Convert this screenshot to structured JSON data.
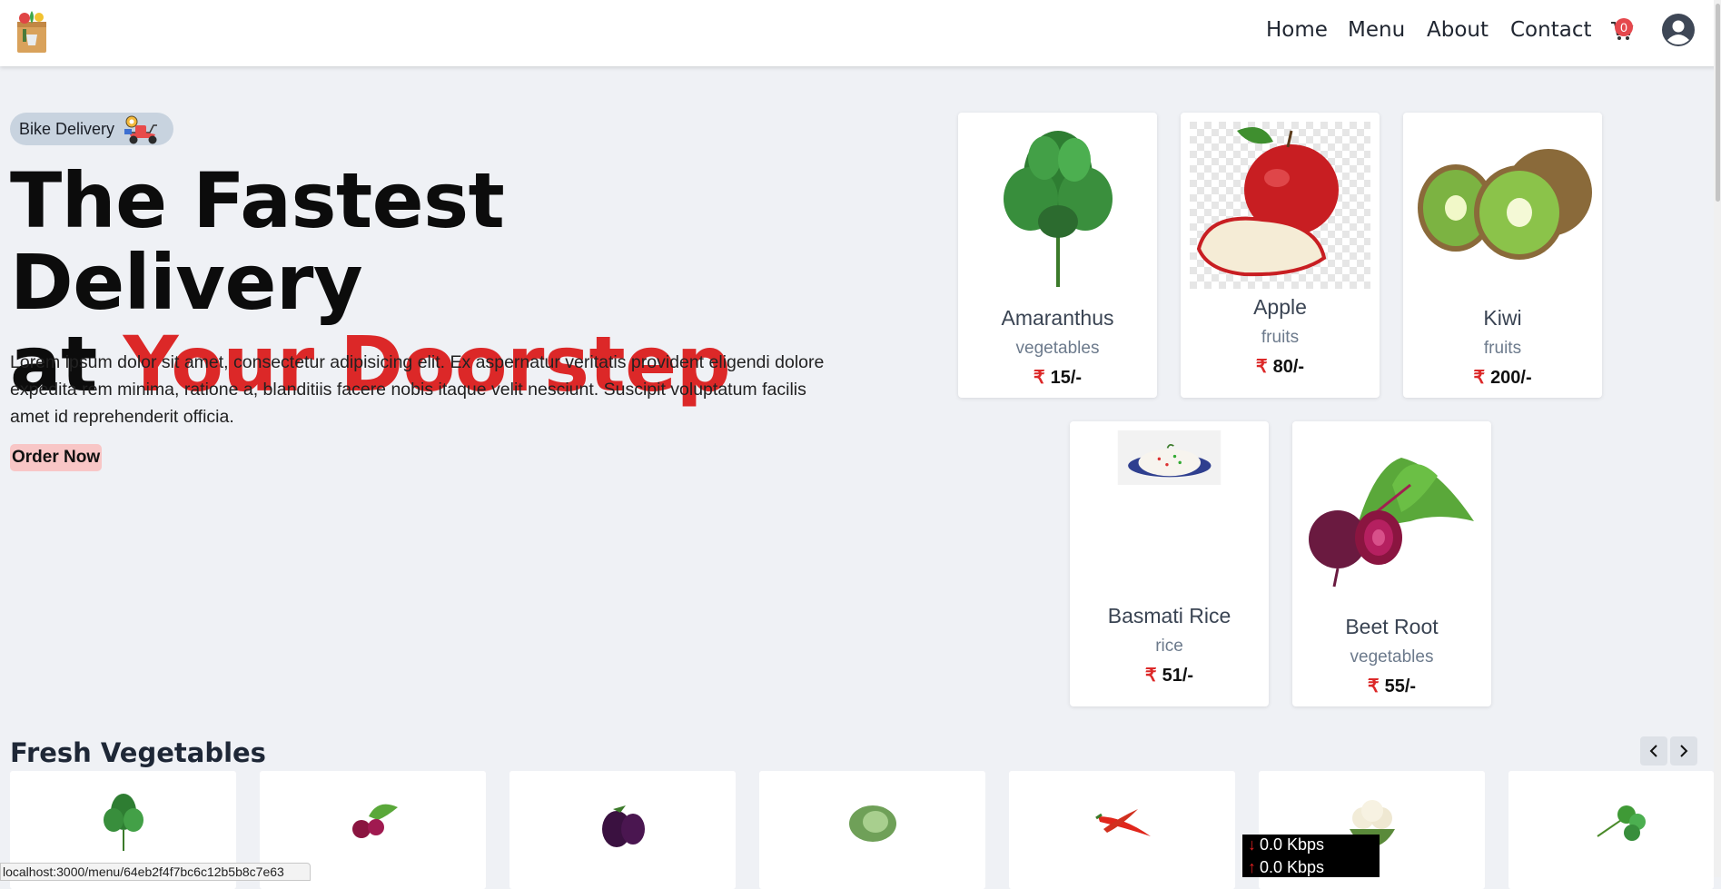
{
  "header": {
    "logo_icon": "grocery-bag-icon",
    "nav": [
      {
        "label": "Home"
      },
      {
        "label": "Menu"
      },
      {
        "label": "About"
      },
      {
        "label": "Contact"
      }
    ],
    "cart_icon": "cart-icon",
    "cart_count": "0",
    "avatar_icon": "user-avatar-icon"
  },
  "hero": {
    "badge_label": "Bike Delivery",
    "badge_icon": "scooter-delivery-icon",
    "title_line1": "The Fastest Delivery",
    "title_line2_prefix": "at",
    "title_line2_highlight": "Your Doorstep",
    "description": "Lorem ipsum dolor sit amet, consectetur adipisicing elit. Ex aspernatur veritatis provident eligendi dolore expedita rem minima, ratione a, blanditiis facere nobis itaque velit nesciunt. Suscipit voluptatum facilis amet id reprehenderit officia.",
    "order_button": "Order Now",
    "accent_color": "#dc2828"
  },
  "products": [
    {
      "name": "Amaranthus",
      "category": "vegetables",
      "price": "15/-",
      "currency": "₹",
      "image_icon": "amaranthus-leaf-icon"
    },
    {
      "name": "Apple",
      "category": "fruits",
      "price": "80/-",
      "currency": "₹",
      "image_icon": "apple-icon"
    },
    {
      "name": "Kiwi",
      "category": "fruits",
      "price": "200/-",
      "currency": "₹",
      "image_icon": "kiwi-icon"
    },
    {
      "name": "Basmati Rice",
      "category": "rice",
      "price": "51/-",
      "currency": "₹",
      "image_icon": "rice-plate-icon"
    },
    {
      "name": "Beet Root",
      "category": "vegetables",
      "price": "55/-",
      "currency": "₹",
      "image_icon": "beetroot-icon"
    }
  ],
  "fresh_vegetables": {
    "title": "Fresh Vegetables",
    "prev_icon": "chevron-left-icon",
    "next_icon": "chevron-right-icon",
    "items": [
      {
        "image_icon": "amaranthus-leaf-icon"
      },
      {
        "image_icon": "radish-icon"
      },
      {
        "image_icon": "eggplant-icon"
      },
      {
        "image_icon": "cabbage-icon"
      },
      {
        "image_icon": "chili-icon"
      },
      {
        "image_icon": "cauliflower-icon"
      },
      {
        "image_icon": "coriander-icon"
      }
    ]
  },
  "overlays": {
    "status_url": "localhost:3000/menu/64eb2f4f7bc6c12b5b8c7e63",
    "net_down": "0.0 Kbps",
    "net_up": "0.0 Kbps"
  }
}
